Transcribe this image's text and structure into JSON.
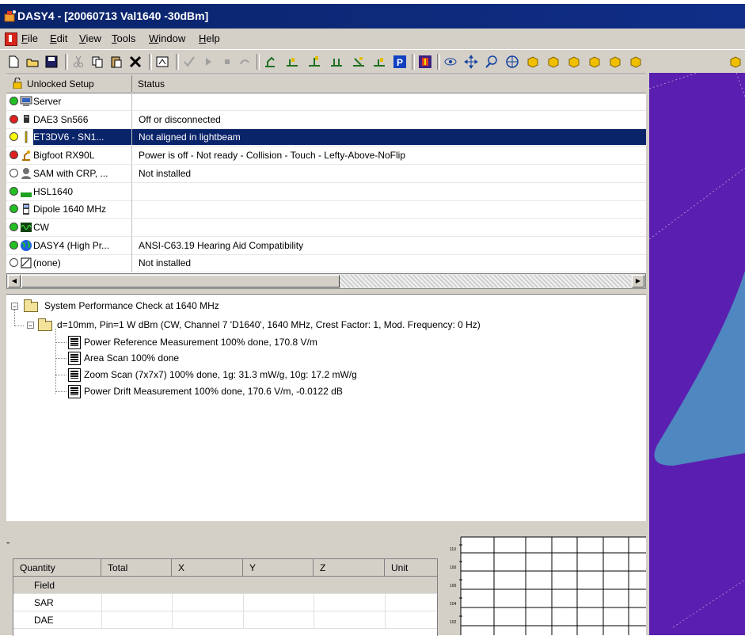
{
  "window": {
    "title": "DASY4 - [20060713 Val1640 -30dBm]"
  },
  "menu": {
    "items": [
      {
        "label": "File",
        "key": "F",
        "rest": "ile"
      },
      {
        "label": "Edit",
        "key": "E",
        "rest": "dit"
      },
      {
        "label": "View",
        "key": "V",
        "rest": "iew"
      },
      {
        "label": "Tools",
        "key": "T",
        "rest": "ools"
      },
      {
        "label": "Window",
        "key": "W",
        "rest": "indow"
      },
      {
        "label": "Help",
        "key": "H",
        "rest": "elp"
      }
    ]
  },
  "toolbar": {
    "icons": [
      "new-icon",
      "open-icon",
      "save-icon",
      "cut-icon",
      "copy-icon",
      "paste-icon",
      "delete-icon",
      "properties-icon",
      "check-icon",
      "play-icon",
      "stop-icon",
      "undo-icon",
      "robot-icon",
      "measure-icon",
      "measure2-icon",
      "measure3-icon",
      "measure4-icon",
      "measure5-icon",
      "p-icon",
      "stop-red-icon",
      "view-icon",
      "move-icon",
      "zoom-icon",
      "target-icon",
      "cube1-icon",
      "cube2-icon",
      "cube3-icon",
      "cube4-icon",
      "cube5-icon",
      "cube6-icon"
    ]
  },
  "setup": {
    "header_left": "Unlocked Setup",
    "header_right": "Status",
    "rows": [
      {
        "name": "Server",
        "status": "",
        "dot": "#22c022",
        "icon": "server-icon"
      },
      {
        "name": "DAE3 Sn566",
        "status": "Off or disconnected",
        "dot": "#e02020",
        "icon": "dae-icon"
      },
      {
        "name": "ET3DV6 - SN1...",
        "status": "Not aligned in lightbeam",
        "dot": "#ffff00",
        "icon": "probe-icon",
        "selected": true
      },
      {
        "name": "Bigfoot RX90L",
        "status": "Power is off - Not ready - Collision - Touch - Lefty-Above-NoFlip",
        "dot": "#e02020",
        "icon": "robot-arm-icon"
      },
      {
        "name": "SAM with CRP, ...",
        "status": "Not installed",
        "dot": "#ffffff",
        "icon": "phantom-icon"
      },
      {
        "name": "HSL1640",
        "status": "",
        "dot": "#22c022",
        "icon": "liquid-icon"
      },
      {
        "name": "Dipole 1640 MHz",
        "status": "",
        "dot": "#22c022",
        "icon": "dipole-icon"
      },
      {
        "name": "CW",
        "status": "",
        "dot": "#22c022",
        "icon": "signal-icon"
      },
      {
        "name": "DASY4 (High Pr...",
        "status": "ANSI-C63.19 Hearing Aid Compatibility",
        "dot": "#22c022",
        "icon": "globe-icon"
      },
      {
        "name": "(none)",
        "status": "Not installed",
        "dot": "#ffffff",
        "icon": "device-icon"
      }
    ]
  },
  "tree": {
    "root": "System Performance Check at 1640 MHz",
    "child": "d=10mm, Pin=1 W dBm (CW, Channel 7 'D1640', 1640 MHz, Crest Factor: 1, Mod. Frequency: 0 Hz)",
    "leaves": [
      "Power Reference Measurement 100% done, 170.8 V/m",
      "Area Scan 100% done",
      "Zoom Scan (7x7x7) 100% done, 1g: 31.3 mW/g, 10g: 17.2 mW/g",
      "Power Drift Measurement 100% done, 170.6 V/m, -0.0122 dB"
    ]
  },
  "bottom": {
    "dash": "-",
    "columns": [
      "Quantity",
      "Total",
      "X",
      "Y",
      "Z",
      "Unit"
    ],
    "rows": [
      "Field",
      "SAR",
      "DAE"
    ]
  },
  "colors": {
    "titlebar": "#0a246a",
    "selection": "#0a246a",
    "view_bg": "#5a1fb0",
    "view_shape": "#4f87c0"
  }
}
